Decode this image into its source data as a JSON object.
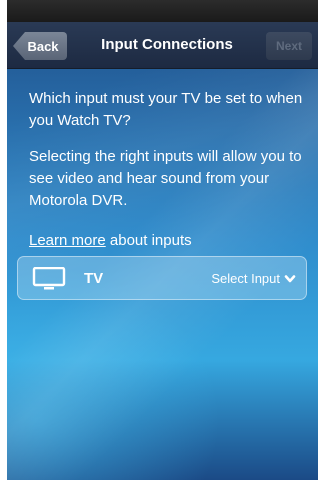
{
  "nav": {
    "back_label": "Back",
    "title": "Input Connections",
    "next_label": "Next"
  },
  "content": {
    "question": "Which input must your TV be set to when you Watch TV?",
    "explanation": "Selecting the right inputs will allow you to see video and hear sound from your Motorola DVR.",
    "learn_more_link": "Learn more",
    "learn_more_suffix": " about inputs"
  },
  "input_row": {
    "icon": "tv-icon",
    "label": "TV",
    "select_label": "Select Input",
    "select_icon": "chevron-down-icon"
  },
  "colors": {
    "nav_background": "#1d2a42",
    "content_gradient_top": "#1f4d86",
    "content_gradient_mid": "#36a8e0",
    "text": "#ffffff",
    "next_disabled_text": "#5f6b7e"
  }
}
